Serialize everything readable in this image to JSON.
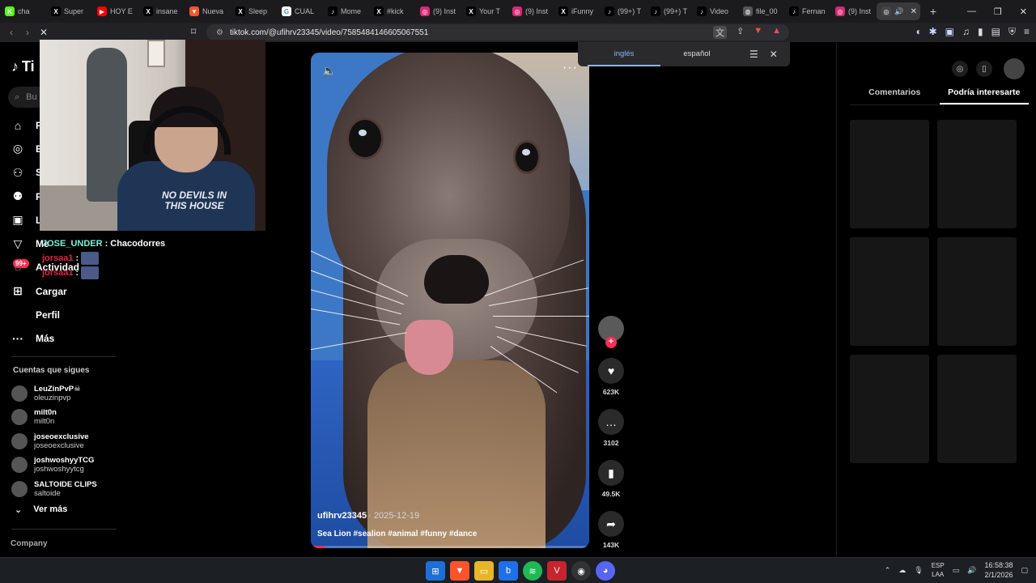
{
  "browser": {
    "tabs": [
      {
        "label": "cha",
        "icon": "kick-icon",
        "color": "#53fc18"
      },
      {
        "label": "Super",
        "icon": "x-icon",
        "color": "#000000"
      },
      {
        "label": "HOY E",
        "icon": "youtube-icon",
        "color": "#ff0000"
      },
      {
        "label": "insane",
        "icon": "x-icon",
        "color": "#000000"
      },
      {
        "label": "Nueva",
        "icon": "brave-icon",
        "color": "#fb542b"
      },
      {
        "label": "Sleep",
        "icon": "x-icon",
        "color": "#000000"
      },
      {
        "label": "CUAL",
        "icon": "google-icon",
        "color": "#ffffff"
      },
      {
        "label": "Mome",
        "icon": "tiktok-icon",
        "color": "#000000"
      },
      {
        "label": "#kick",
        "icon": "x-icon",
        "color": "#000000"
      },
      {
        "label": "(9) Inst",
        "icon": "instagram-icon",
        "color": "#d62976"
      },
      {
        "label": "Your T",
        "icon": "x-icon",
        "color": "#000000"
      },
      {
        "label": "(9) Inst",
        "icon": "instagram-icon",
        "color": "#d62976"
      },
      {
        "label": "iFunny",
        "icon": "x-icon",
        "color": "#000000"
      },
      {
        "label": "(99+) T",
        "icon": "tiktok-icon",
        "color": "#000000"
      },
      {
        "label": "(99+) T",
        "icon": "tiktok-icon",
        "color": "#000000"
      },
      {
        "label": "Video",
        "icon": "tiktok-icon",
        "color": "#000000"
      },
      {
        "label": "file_00",
        "icon": "globe-icon",
        "color": "#555555"
      },
      {
        "label": "Fernan",
        "icon": "tiktok-icon",
        "color": "#000000"
      },
      {
        "label": "(9) Inst",
        "icon": "instagram-icon",
        "color": "#d62976"
      }
    ],
    "new_tab": "+",
    "url": "tiktok.com/@ufihrv23345/video/7585484146605067551"
  },
  "translate_bar": {
    "lang_selected": "inglés",
    "lang_other": "español"
  },
  "sidebar": {
    "logo": "Ti",
    "search_placeholder": "Bu",
    "nav": [
      {
        "label": "P",
        "icon": "home-icon"
      },
      {
        "label": "E",
        "icon": "compass-icon"
      },
      {
        "label": "S",
        "icon": "following-icon"
      },
      {
        "label": "F",
        "icon": "friends-icon"
      },
      {
        "label": "L",
        "icon": "live-icon"
      },
      {
        "label": "Me",
        "icon": "messages-icon"
      },
      {
        "label": "Actividad",
        "icon": "activity-icon"
      },
      {
        "label": "Cargar",
        "icon": "upload-icon"
      },
      {
        "label": "Perfil",
        "icon": "profile-icon"
      },
      {
        "label": "Más",
        "icon": "more-icon"
      }
    ],
    "activity_badge": "99+",
    "following_title": "Cuentas que sigues",
    "following": [
      {
        "name": "LeuZinPvP☠",
        "handle": "oleuzinpvp"
      },
      {
        "name": "milt0n",
        "handle": "milt0n"
      },
      {
        "name": "joseoexclusive",
        "handle": "joseoexclusive"
      },
      {
        "name": "joshwoshyyTCG",
        "handle": "joshwoshyytcg"
      },
      {
        "name": "SALTOIDE CLIPS",
        "handle": "saltoide"
      }
    ],
    "see_more": "Ver más",
    "company": "Company"
  },
  "webcam": {
    "shirt_text": "NO DEVILS IN THIS HOUSE"
  },
  "chat": {
    "messages": [
      {
        "user": "JOSE_UNDER",
        "text": "Chacodorres"
      },
      {
        "user": "jorsaa1",
        "text": ""
      },
      {
        "user": "jorsaa1",
        "text": ""
      }
    ]
  },
  "video": {
    "author": "ufihrv23345",
    "date": "· 2025-12-19",
    "description": "Sea Lion #sealion #animal #funny #dance",
    "progress": 0.05
  },
  "actions": {
    "likes": "623K",
    "comments": "3102",
    "saves": "49.5K",
    "shares": "143K"
  },
  "right_panel": {
    "tabs": [
      "Comentarios",
      "Podría interesarte"
    ],
    "selected_tab": 1
  },
  "taskbar": {
    "lang_top": "ESP",
    "lang_bottom": "LAA",
    "time": "16:58:38",
    "date": "2/1/2026"
  }
}
